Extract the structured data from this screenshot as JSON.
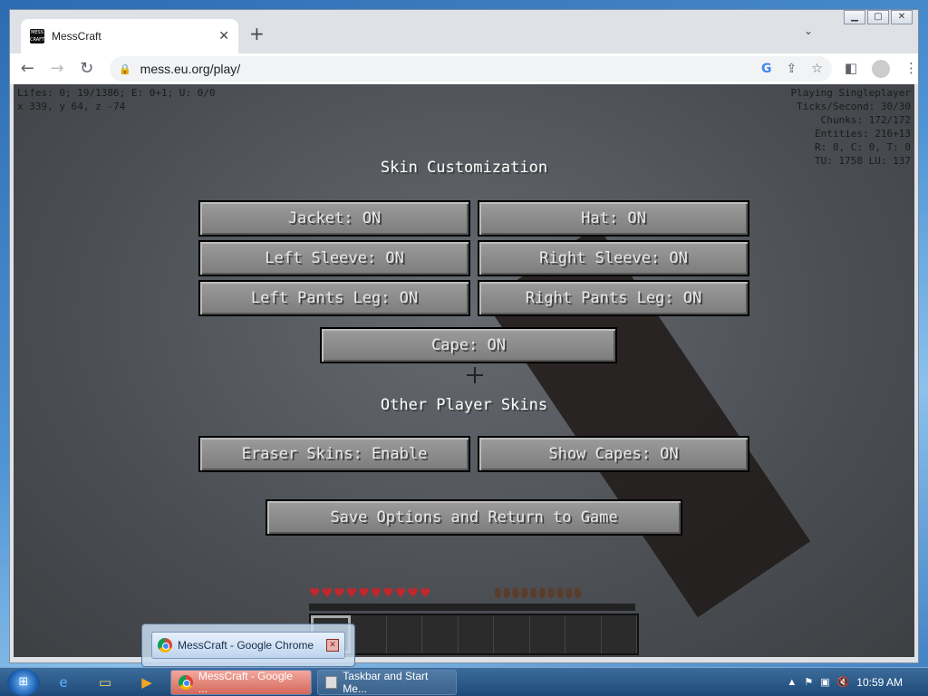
{
  "browser": {
    "tab_title": "MessCraft",
    "favicon_text": "MESS CRAFT",
    "url": "mess.eu.org/play/",
    "new_tab": "+",
    "tab_close": "✕",
    "tab_menu": "⌄"
  },
  "game": {
    "debug_left": [
      "Lifes: 0; 19/1386; E: 0+1; U: 0/0",
      "x 339, y 64, z -74"
    ],
    "debug_right": [
      "Playing Singleplayer",
      "Ticks/Second: 30/30",
      "Chunks: 172/172",
      "Entities: 216+13",
      "R: 0, C: 0, T: 0",
      "TU: 1758 LU: 137"
    ],
    "skin_title": "Skin Customization",
    "buttons": {
      "jacket": "Jacket: ON",
      "hat": "Hat: ON",
      "left_sleeve": "Left Sleeve: ON",
      "right_sleeve": "Right Sleeve: ON",
      "left_pants": "Left Pants Leg: ON",
      "right_pants": "Right Pants Leg: ON",
      "cape": "Cape: ON",
      "eraser": "Eraser Skins: Enable",
      "show_capes": "Show Capes: ON",
      "save": "Save Options and Return to Game"
    },
    "other_title": "Other Player Skins"
  },
  "taskbar": {
    "popup_title": "MessCraft - Google Chrome",
    "task_chrome": "MessCraft - Google ...",
    "task_second": "Taskbar and Start Me...",
    "clock": "10:59 AM"
  },
  "colors": {
    "mc_button": "#8b8b8b",
    "mc_text": "#e8e8e8",
    "taskbar": "#1e4a78"
  }
}
